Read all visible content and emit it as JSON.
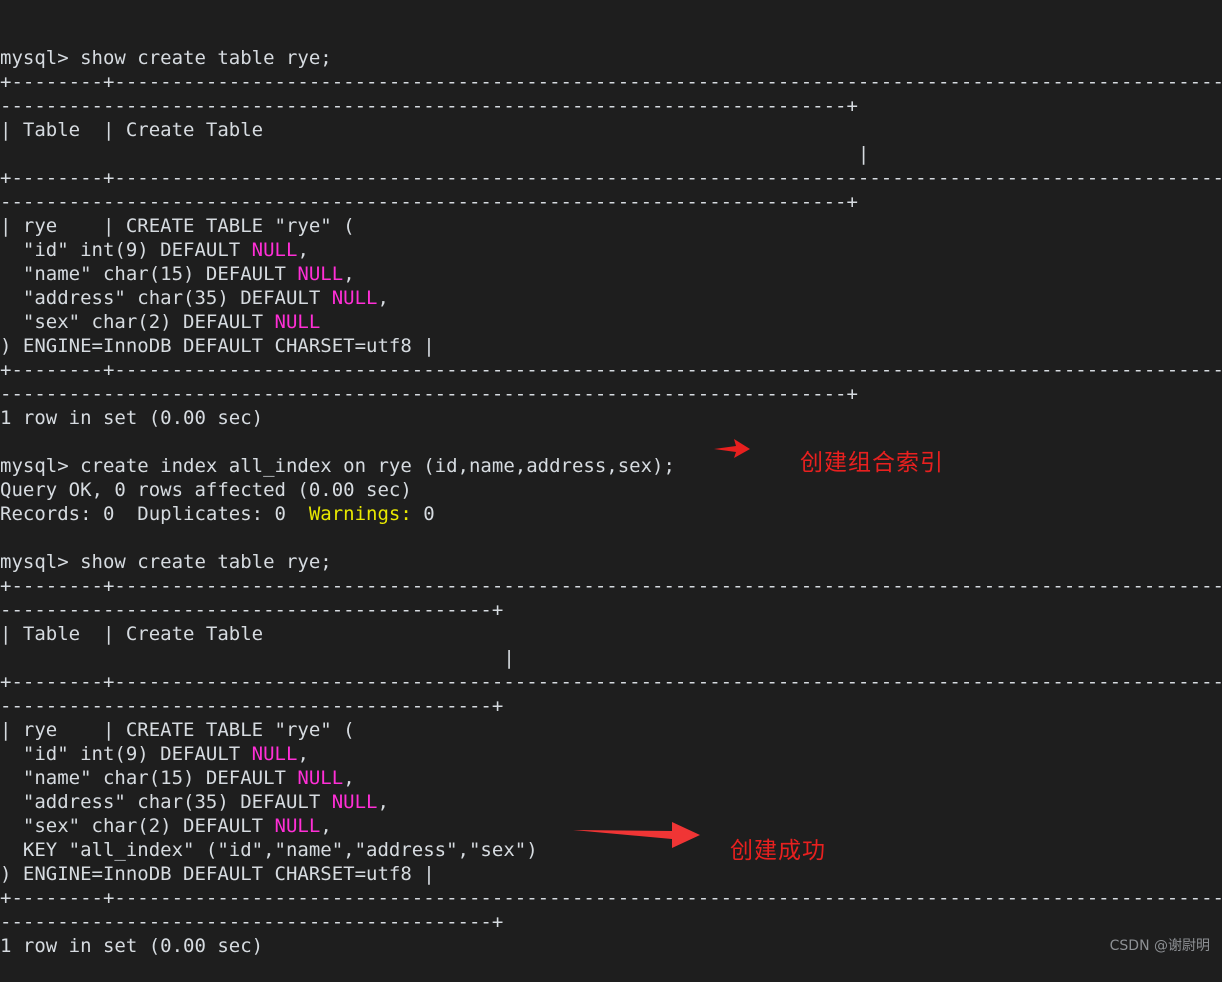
{
  "terminal": {
    "background_color": "#1e1e1e",
    "foreground_color": "#d6dbe0",
    "null_color": "#ff2fd6",
    "warning_color": "#e8e800",
    "annotation_color": "#e8201f",
    "lines": [
      {
        "id": "l01",
        "text": "mysql> show create table rye;"
      },
      {
        "id": "l02",
        "text": "+--------+-----------------------------------------------------------------------------------------------------------------"
      },
      {
        "id": "l03",
        "text": "--------------------------------------------------------------------------+"
      },
      {
        "id": "l04",
        "text": "| Table  | Create Table"
      },
      {
        "id": "l05",
        "text": "                                                                           |"
      },
      {
        "id": "l06",
        "text": "+--------+-----------------------------------------------------------------------------------------------------------------"
      },
      {
        "id": "l07",
        "text": "--------------------------------------------------------------------------+"
      },
      {
        "id": "l08",
        "text": "| rye    | CREATE TABLE \"rye\" ("
      },
      {
        "id": "l09",
        "prefix": "  \"id\" int(9) DEFAULT ",
        "null": "NULL",
        "suffix": ","
      },
      {
        "id": "l10",
        "prefix": "  \"name\" char(15) DEFAULT ",
        "null": "NULL",
        "suffix": ","
      },
      {
        "id": "l11",
        "prefix": "  \"address\" char(35) DEFAULT ",
        "null": "NULL",
        "suffix": ","
      },
      {
        "id": "l12",
        "prefix": "  \"sex\" char(2) DEFAULT ",
        "null": "NULL",
        "suffix": ""
      },
      {
        "id": "l13",
        "text": ") ENGINE=InnoDB DEFAULT CHARSET=utf8 |"
      },
      {
        "id": "l14",
        "text": "+--------+-----------------------------------------------------------------------------------------------------------------"
      },
      {
        "id": "l15",
        "text": "--------------------------------------------------------------------------+"
      },
      {
        "id": "l16",
        "text": "1 row in set (0.00 sec)"
      },
      {
        "id": "l17",
        "text": ""
      },
      {
        "id": "l18",
        "text": "mysql> create index all_index on rye (id,name,address,sex);"
      },
      {
        "id": "l19",
        "text": "Query OK, 0 rows affected (0.00 sec)"
      },
      {
        "id": "l20",
        "prefix": "Records: 0  Duplicates: 0  ",
        "warn": "Warnings:",
        "suffix": " 0"
      },
      {
        "id": "l21",
        "text": ""
      },
      {
        "id": "l22",
        "text": "mysql> show create table rye;"
      },
      {
        "id": "l23",
        "text": "+--------+-----------------------------------------------------------------------------------------------------------------"
      },
      {
        "id": "l24",
        "text": "-------------------------------------------+"
      },
      {
        "id": "l25",
        "text": "| Table  | Create Table"
      },
      {
        "id": "l26",
        "text": "                                            |"
      },
      {
        "id": "l27",
        "text": "+--------+-----------------------------------------------------------------------------------------------------------------"
      },
      {
        "id": "l28",
        "text": "-------------------------------------------+"
      },
      {
        "id": "l29",
        "text": "| rye    | CREATE TABLE \"rye\" ("
      },
      {
        "id": "l30",
        "prefix": "  \"id\" int(9) DEFAULT ",
        "null": "NULL",
        "suffix": ","
      },
      {
        "id": "l31",
        "prefix": "  \"name\" char(15) DEFAULT ",
        "null": "NULL",
        "suffix": ","
      },
      {
        "id": "l32",
        "prefix": "  \"address\" char(35) DEFAULT ",
        "null": "NULL",
        "suffix": ","
      },
      {
        "id": "l33",
        "prefix": "  \"sex\" char(2) DEFAULT ",
        "null": "NULL",
        "suffix": ","
      },
      {
        "id": "l34",
        "text": "  KEY \"all_index\" (\"id\",\"name\",\"address\",\"sex\")"
      },
      {
        "id": "l35",
        "text": ") ENGINE=InnoDB DEFAULT CHARSET=utf8 |"
      },
      {
        "id": "l36",
        "text": "+--------+-----------------------------------------------------------------------------------------------------------------"
      },
      {
        "id": "l37",
        "text": "-------------------------------------------+"
      },
      {
        "id": "l38",
        "text": "1 row in set (0.00 sec)"
      }
    ]
  },
  "annotations": {
    "create_composite_index": "创建组合索引",
    "created_successfully": "创建成功"
  },
  "watermark": {
    "text": "CSDN @谢尉明"
  }
}
